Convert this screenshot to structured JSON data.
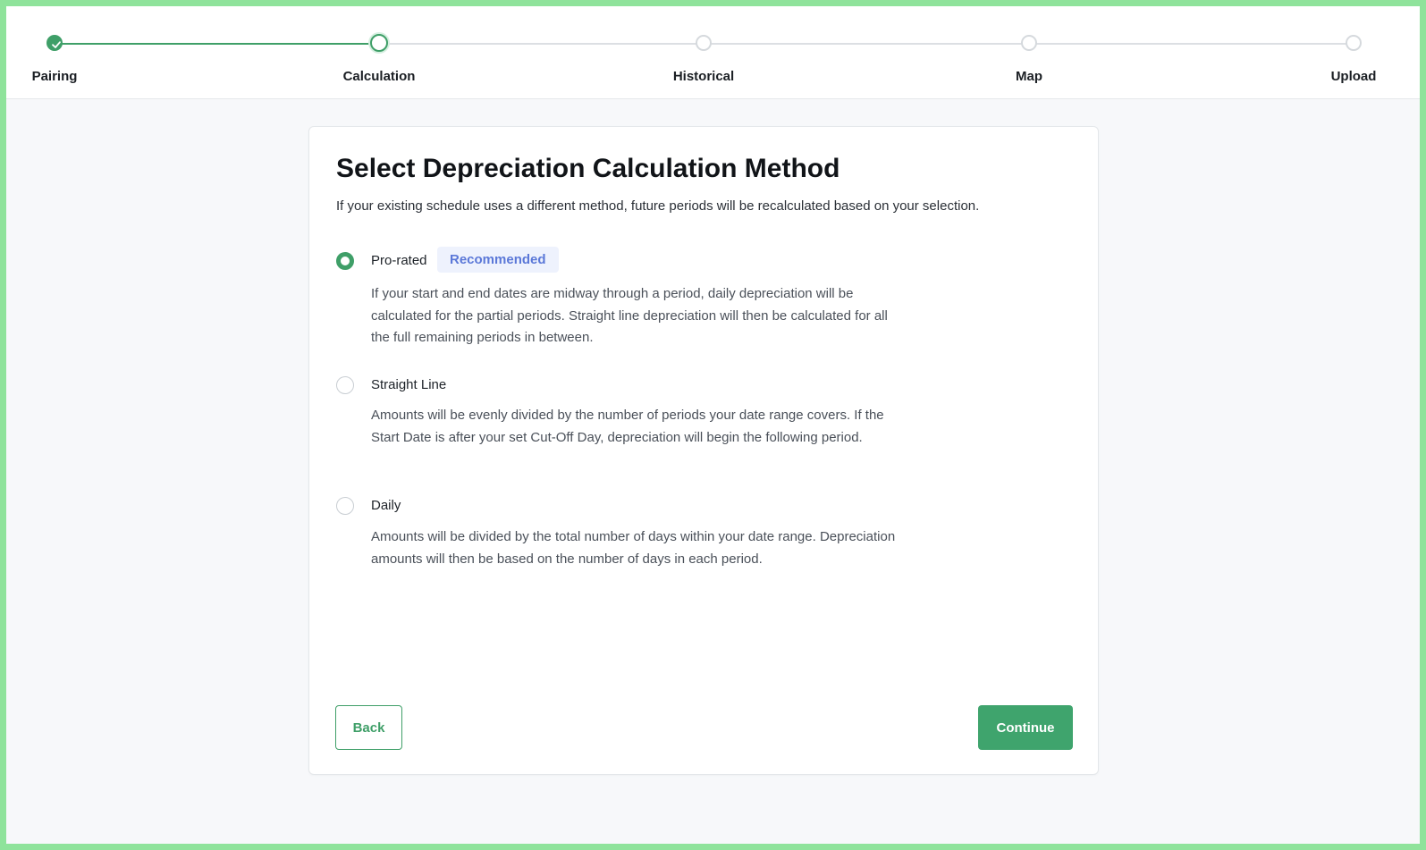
{
  "steps": [
    {
      "label": "Pairing",
      "state": "complete"
    },
    {
      "label": "Calculation",
      "state": "current"
    },
    {
      "label": "Historical",
      "state": "upcoming"
    },
    {
      "label": "Map",
      "state": "upcoming"
    },
    {
      "label": "Upload",
      "state": "upcoming"
    }
  ],
  "card": {
    "title": "Select Depreciation Calculation Method",
    "subtitle": "If your existing schedule uses a different method, future periods will be recalculated based on your selection."
  },
  "options": [
    {
      "label": "Pro-rated",
      "badge": "Recommended",
      "selected": true,
      "description": "If your start and end dates are midway through a period, daily depreciation will be calculated for the partial periods. Straight line depreciation will then be calculated for all the full remaining periods in between."
    },
    {
      "label": "Straight Line",
      "selected": false,
      "description": "Amounts will be evenly divided by the number of periods your date range covers. If the Start Date is after your set Cut-Off Day, depreciation will begin the following period."
    },
    {
      "label": "Daily",
      "selected": false,
      "description": "Amounts will be divided by the total number of days within your date range. Depreciation amounts will then be based on the number of days in each period."
    }
  ],
  "buttons": {
    "back": "Back",
    "continue": "Continue"
  },
  "colors": {
    "accent": "#3f9f68",
    "badge_bg": "#eef2fd",
    "badge_text": "#5b78d8",
    "frame": "#8fe39b"
  }
}
